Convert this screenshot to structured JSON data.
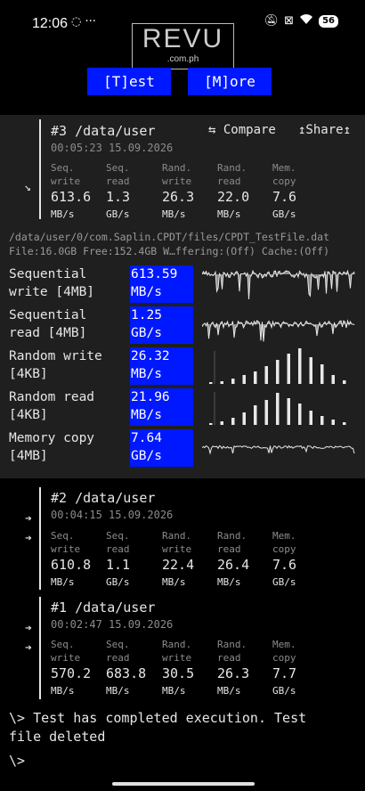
{
  "status_bar": {
    "time": "12:06",
    "left_icons": "◌ ···",
    "battery": "56"
  },
  "watermark": {
    "brand": "REVU",
    "domain": ".com.ph"
  },
  "toolbar": {
    "test_label": "[T]est",
    "more_label": "[M]ore"
  },
  "runs": [
    {
      "title": "#3 /data/user",
      "timestamp": "00:05:23 15.09.2026",
      "compare_label": "⇆ Compare",
      "share_label": "↥Share↥",
      "metrics": [
        {
          "l1": "Seq.",
          "l2": "write",
          "value": "613.6",
          "unit": "MB/s"
        },
        {
          "l1": "Seq.",
          "l2": "read",
          "value": "1.3",
          "unit": "GB/s"
        },
        {
          "l1": "Rand.",
          "l2": "write",
          "value": "26.3",
          "unit": "MB/s"
        },
        {
          "l1": "Rand.",
          "l2": "read",
          "value": "22.0",
          "unit": "MB/s"
        },
        {
          "l1": "Mem.",
          "l2": "copy",
          "value": "7.6",
          "unit": "GB/s"
        }
      ]
    },
    {
      "title": "#2 /data/user",
      "timestamp": "00:04:15 15.09.2026",
      "metrics": [
        {
          "l1": "Seq.",
          "l2": "write",
          "value": "610.8",
          "unit": "MB/s"
        },
        {
          "l1": "Seq.",
          "l2": "read",
          "value": "1.1",
          "unit": "GB/s"
        },
        {
          "l1": "Rand.",
          "l2": "write",
          "value": "22.4",
          "unit": "MB/s"
        },
        {
          "l1": "Rand.",
          "l2": "read",
          "value": "26.4",
          "unit": "MB/s"
        },
        {
          "l1": "Mem.",
          "l2": "copy",
          "value": "7.6",
          "unit": "GB/s"
        }
      ]
    },
    {
      "title": "#1 /data/user",
      "timestamp": "00:02:47 15.09.2026",
      "metrics": [
        {
          "l1": "Seq.",
          "l2": "write",
          "value": "570.2",
          "unit": "MB/s"
        },
        {
          "l1": "Seq.",
          "l2": "read",
          "value": "683.8",
          "unit": "MB/s"
        },
        {
          "l1": "Rand.",
          "l2": "write",
          "value": "30.5",
          "unit": "MB/s"
        },
        {
          "l1": "Rand.",
          "l2": "read",
          "value": "26.3",
          "unit": "MB/s"
        },
        {
          "l1": "Mem.",
          "l2": "copy",
          "value": "7.7",
          "unit": "GB/s"
        }
      ]
    }
  ],
  "file_info": {
    "path": "/data/user/0/com.Saplin.CPDT/files/CPDT_TestFile.dat",
    "details": "File:16.0GB Free:152.4GB W…ffering:(Off) Cache:(Off)"
  },
  "results": [
    {
      "name1": "Sequential",
      "name2": "write [4MB]",
      "value": "613.59",
      "unit": "MB/s"
    },
    {
      "name1": "Sequential",
      "name2": "read [4MB]",
      "value": "1.25",
      "unit": "GB/s"
    },
    {
      "name1": "Random write",
      "name2": "[4KB]",
      "value": "26.32",
      "unit": "MB/s"
    },
    {
      "name1": "Random read",
      "name2": "[4KB]",
      "value": "21.96",
      "unit": "MB/s"
    },
    {
      "name1": "Memory copy",
      "name2": "[4MB]",
      "value": "7.64",
      "unit": "GB/s"
    }
  ],
  "console": {
    "done_line1": "\\> Test has completed execution. Test",
    "done_line2": "file deleted",
    "prompt": "\\>"
  },
  "colors": {
    "accent_blue": "#0018ff",
    "panel_bg": "#1f1f1f",
    "text": "#e6e6e6",
    "muted": "#8c8c8c"
  }
}
